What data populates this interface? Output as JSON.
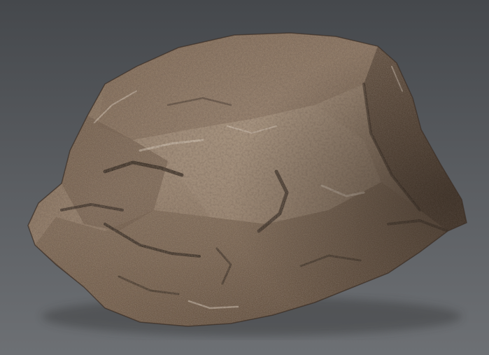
{
  "scene": {
    "subject": "rock-3d-model",
    "colors": {
      "background_top": "#46494d",
      "background_bottom": "#6b6e72",
      "rock_dark": "#3e3128",
      "rock_mid": "#6e5a48",
      "rock_light": "#9c8a76",
      "rock_highlight": "#c9bdb0",
      "shadow": "#2a221c"
    }
  }
}
